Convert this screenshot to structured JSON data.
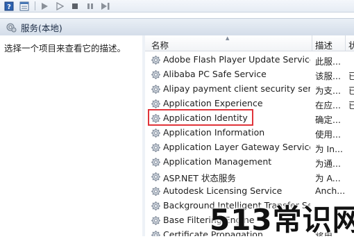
{
  "toolbar": {
    "buttons": [
      {
        "name": "help-icon",
        "glyph": "?"
      },
      {
        "name": "properties-icon",
        "glyph": "▤"
      },
      {
        "name": "play-icon",
        "glyph": "▶"
      },
      {
        "name": "play-alt-icon",
        "glyph": "▷"
      },
      {
        "name": "stop-icon",
        "glyph": "■"
      },
      {
        "name": "pause-icon",
        "glyph": "❚❚"
      },
      {
        "name": "restart-icon",
        "glyph": "▶▮"
      }
    ]
  },
  "header": {
    "title": "服务(本地)"
  },
  "left_pane": {
    "description_prompt": "选择一个项目来查看它的描述。"
  },
  "columns": {
    "name": "名称",
    "description": "描述",
    "status": "状"
  },
  "services": [
    {
      "name": "Adobe Flash Player Update Service",
      "description": "此服...",
      "status": ""
    },
    {
      "name": "Alibaba PC Safe Service",
      "description": "该服...",
      "status": "已"
    },
    {
      "name": "Alipay payment client security servi...",
      "description": "为支...",
      "status": "已"
    },
    {
      "name": "Application Experience",
      "description": "在应...",
      "status": "已"
    },
    {
      "name": "Application Identity",
      "description": "确定...",
      "status": ""
    },
    {
      "name": "Application Information",
      "description": "使用...",
      "status": ""
    },
    {
      "name": "Application Layer Gateway Service",
      "description": "为 In...",
      "status": ""
    },
    {
      "name": "Application Management",
      "description": "为通...",
      "status": ""
    },
    {
      "name": "ASP.NET 状态服务",
      "description": "为 A...",
      "status": ""
    },
    {
      "name": "Autodesk Licensing Service",
      "description": "Anch...",
      "status": ""
    },
    {
      "name": "Background Intelligent Transfer Service",
      "description": "",
      "status": ""
    },
    {
      "name": "Base Filtering Engine",
      "description": "",
      "status": ""
    },
    {
      "name": "Certificate Propagation",
      "description": "将用...",
      "status": ""
    }
  ],
  "highlighted_index": 4,
  "watermark": "513常识网",
  "colors": {
    "highlight_border": "#e0343a",
    "header_bg": "#d4dde9"
  }
}
